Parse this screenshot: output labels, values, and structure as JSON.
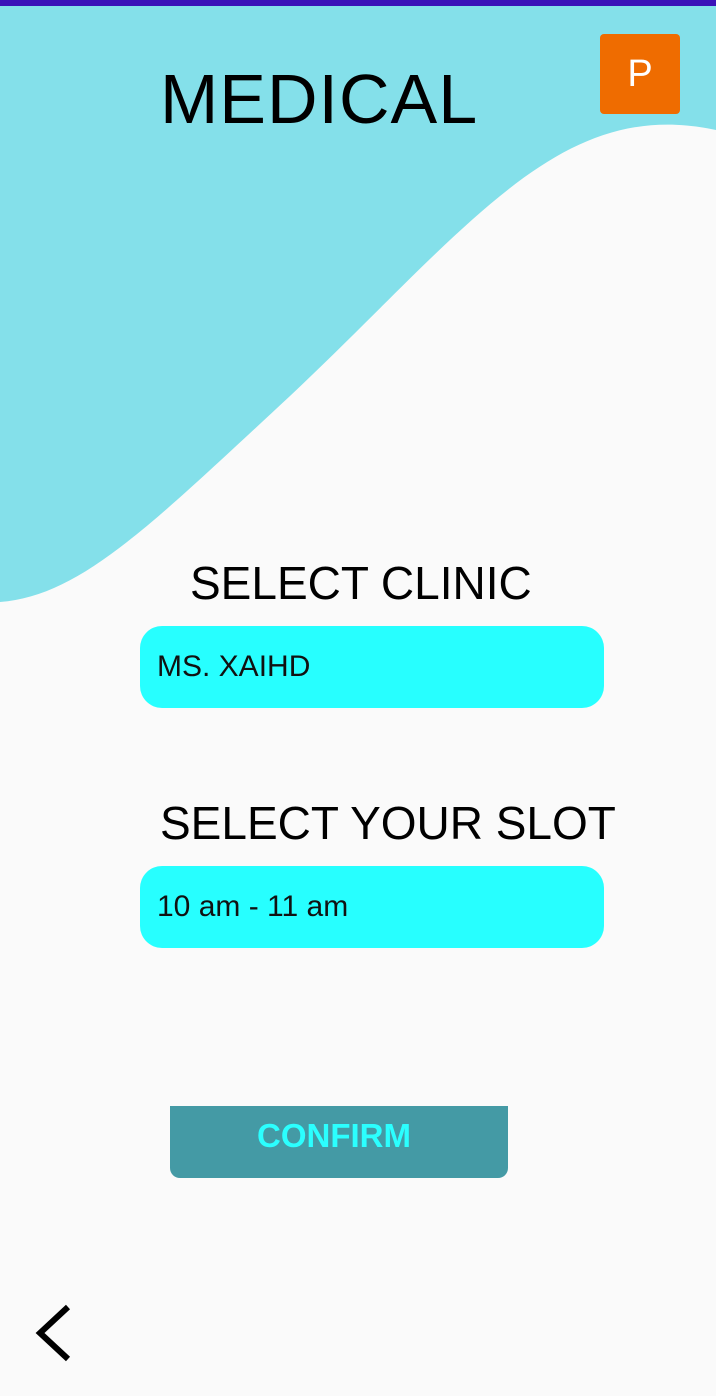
{
  "header": {
    "title": "MEDICAL",
    "profile_initial": "P"
  },
  "clinic": {
    "label": "SELECT CLINIC",
    "selected": "MS. XAIHD"
  },
  "slot": {
    "label": "SELECT YOUR SLOT",
    "selected": "10 am - 11 am"
  },
  "actions": {
    "confirm_label": "CONFIRM",
    "back_icon": "chevron-left-icon"
  },
  "colors": {
    "status_bar": "#3a12b8",
    "wave": "#84e0ea",
    "field": "#27ffff",
    "button": "#449aa5",
    "button_text": "#2bffff",
    "profile": "#ef6c00"
  }
}
